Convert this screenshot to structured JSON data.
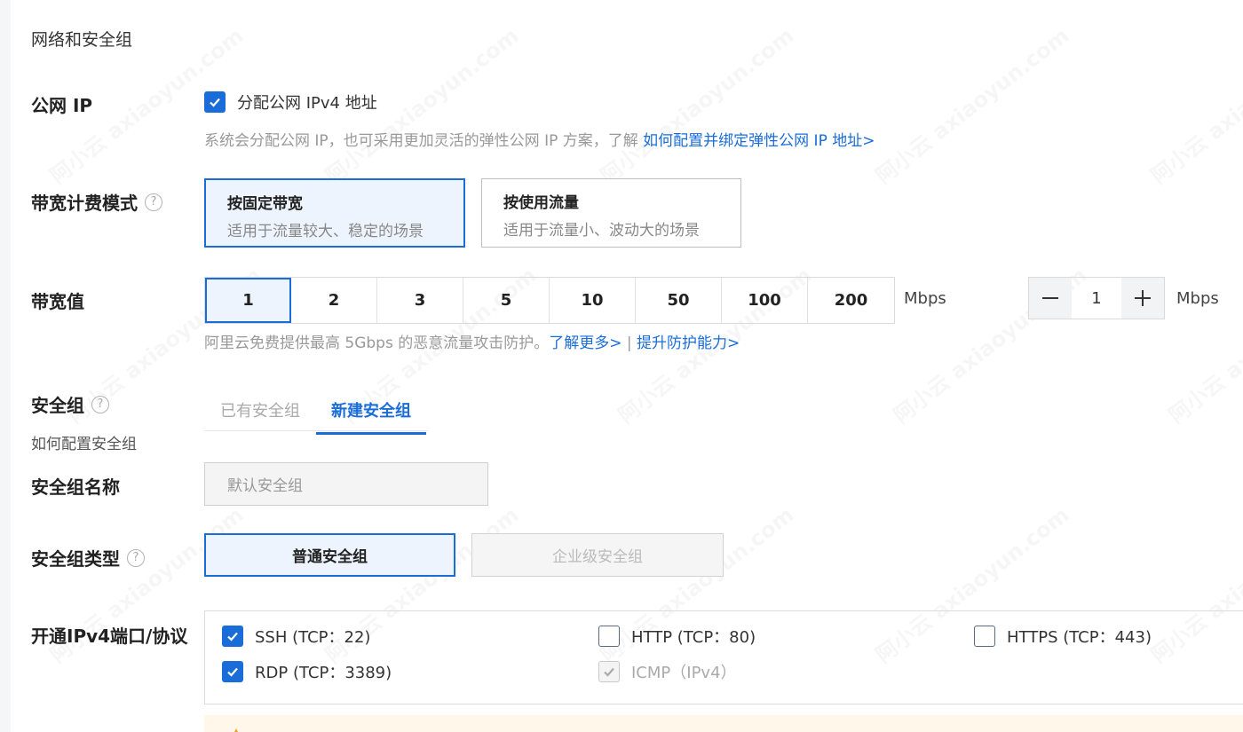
{
  "section_title": "网络和安全组",
  "public_ip": {
    "label": "公网 IP",
    "checkbox_label": "分配公网 IPv4 地址",
    "checked": true,
    "hint_text": "系统会分配公网 IP，也可采用更加灵活的弹性公网 IP 方案，了解 ",
    "hint_link": "如何配置并绑定弹性公网 IP 地址>"
  },
  "billing_mode": {
    "label": "带宽计费模式",
    "options": [
      {
        "title": "按固定带宽",
        "desc": "适用于流量较大、稳定的场景",
        "selected": true
      },
      {
        "title": "按使用流量",
        "desc": "适用于流量小、波动大的场景",
        "selected": false
      }
    ]
  },
  "bandwidth": {
    "label": "带宽值",
    "options": [
      "1",
      "2",
      "3",
      "5",
      "10",
      "50",
      "100",
      "200"
    ],
    "selected": "1",
    "unit": "Mbps",
    "stepper_value": "1",
    "stepper_unit": "Mbps",
    "hint_text": "阿里云免费提供最高 5Gbps 的恶意流量攻击防护。",
    "link_learn": "了解更多>",
    "separator": "|",
    "link_upgrade": "提升防护能力>"
  },
  "security_group": {
    "label": "安全组",
    "help_link": "如何配置安全组",
    "tabs": [
      {
        "label": "已有安全组",
        "active": false
      },
      {
        "label": "新建安全组",
        "active": true
      }
    ],
    "name_label": "安全组名称",
    "name_placeholder": "默认安全组",
    "type_label": "安全组类型",
    "types": [
      {
        "label": "普通安全组",
        "selected": true
      },
      {
        "label": "企业级安全组",
        "disabled": true
      }
    ]
  },
  "ports": {
    "label": "开通IPv4端口/协议",
    "items": [
      {
        "label": "SSH (TCP：22)",
        "checked": true
      },
      {
        "label": "HTTP (TCP：80)",
        "checked": false
      },
      {
        "label": "HTTPS (TCP：443)",
        "checked": false
      },
      {
        "label": "RDP (TCP：3389)",
        "checked": true
      },
      {
        "label": "ICMP（IPv4）",
        "checked": true,
        "disabled": true
      }
    ]
  },
  "watermark": [
    "阿小云",
    "axiaoyun.com"
  ],
  "colors": {
    "accent": "#1a6dd8",
    "selected_bg": "#edf4fd",
    "warning_bg": "#fef7ea"
  }
}
